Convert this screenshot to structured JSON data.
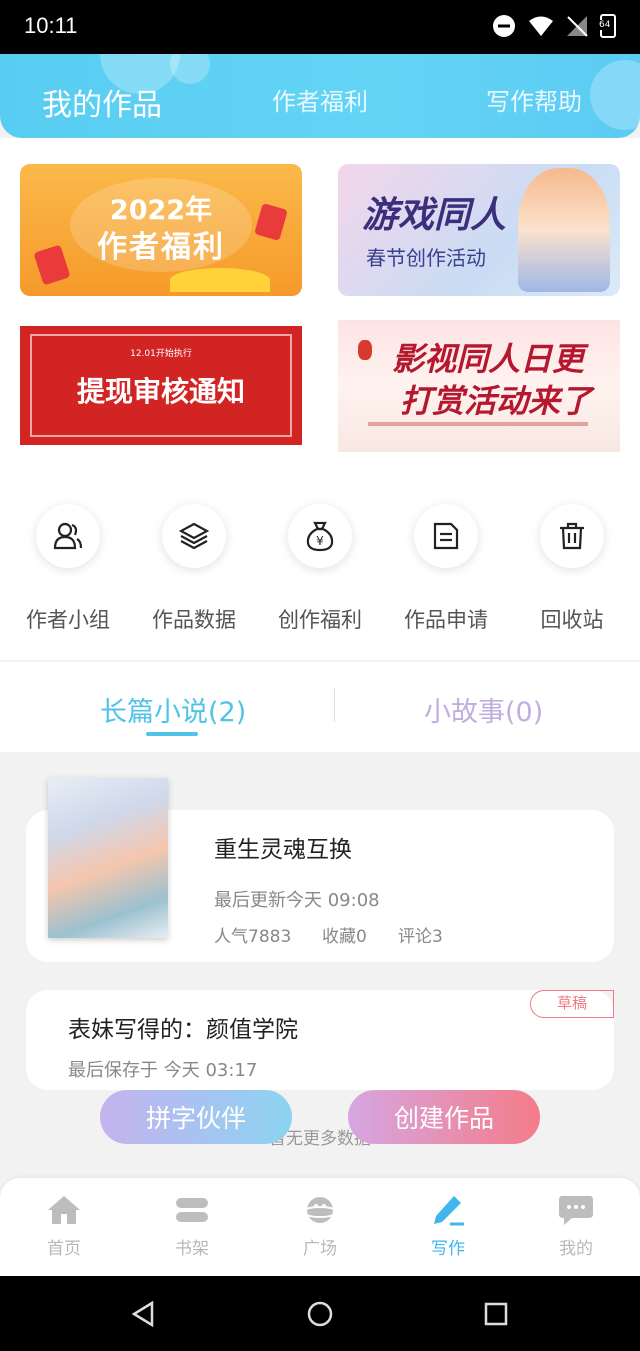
{
  "status_bar": {
    "time": "10:11",
    "battery": "64"
  },
  "header": {
    "tabs": [
      {
        "label": "我的作品",
        "active": true
      },
      {
        "label": "作者福利",
        "active": false
      },
      {
        "label": "写作帮助",
        "active": false
      }
    ]
  },
  "banners": [
    {
      "name": "author-welfare-banner",
      "line1": "2022年",
      "line2": "作者福利"
    },
    {
      "name": "game-fanfic-banner",
      "line1": "游戏同人",
      "line2": "春节创作活动"
    },
    {
      "name": "withdraw-notice-banner",
      "small": "12.01开始执行",
      "title": "提现审核通知"
    },
    {
      "name": "film-fanfic-banner",
      "title1": "影视同人日更",
      "title2": "打赏活动来了"
    }
  ],
  "shortcuts": [
    {
      "label": "作者小组",
      "icon": "group-icon"
    },
    {
      "label": "作品数据",
      "icon": "layers-icon"
    },
    {
      "label": "创作福利",
      "icon": "money-bag-icon"
    },
    {
      "label": "作品申请",
      "icon": "document-icon"
    },
    {
      "label": "回收站",
      "icon": "trash-icon"
    }
  ],
  "works_tabs": [
    {
      "label": "长篇小说(2)",
      "active": true
    },
    {
      "label": "小故事(0)",
      "active": false
    }
  ],
  "works": [
    {
      "title": "重生灵魂互换",
      "updated": "最后更新今天 09:08",
      "popularity": "人气7883",
      "favorites": "收藏0",
      "comments": "评论3"
    },
    {
      "title": "表妹写得的：颜值学院",
      "saved": "最后保存于 今天 03:17",
      "badge": "草稿"
    }
  ],
  "no_more_text": "暂无更多数据",
  "float_buttons": {
    "partner": "拼字伙伴",
    "create": "创建作品"
  },
  "bottom_nav": [
    {
      "label": "首页",
      "icon": "home-icon",
      "active": false
    },
    {
      "label": "书架",
      "icon": "bookshelf-icon",
      "active": false
    },
    {
      "label": "广场",
      "icon": "planet-icon",
      "active": false
    },
    {
      "label": "写作",
      "icon": "pen-icon",
      "active": true
    },
    {
      "label": "我的",
      "icon": "chat-bubble-icon",
      "active": false
    }
  ],
  "colors": {
    "accent": "#5ccbf3",
    "active_tab_text": "#4fc3e8",
    "inactive_tab_text": "#c0aee0",
    "draft_badge": "#f27a86",
    "nav_active": "#3fb6ec"
  }
}
